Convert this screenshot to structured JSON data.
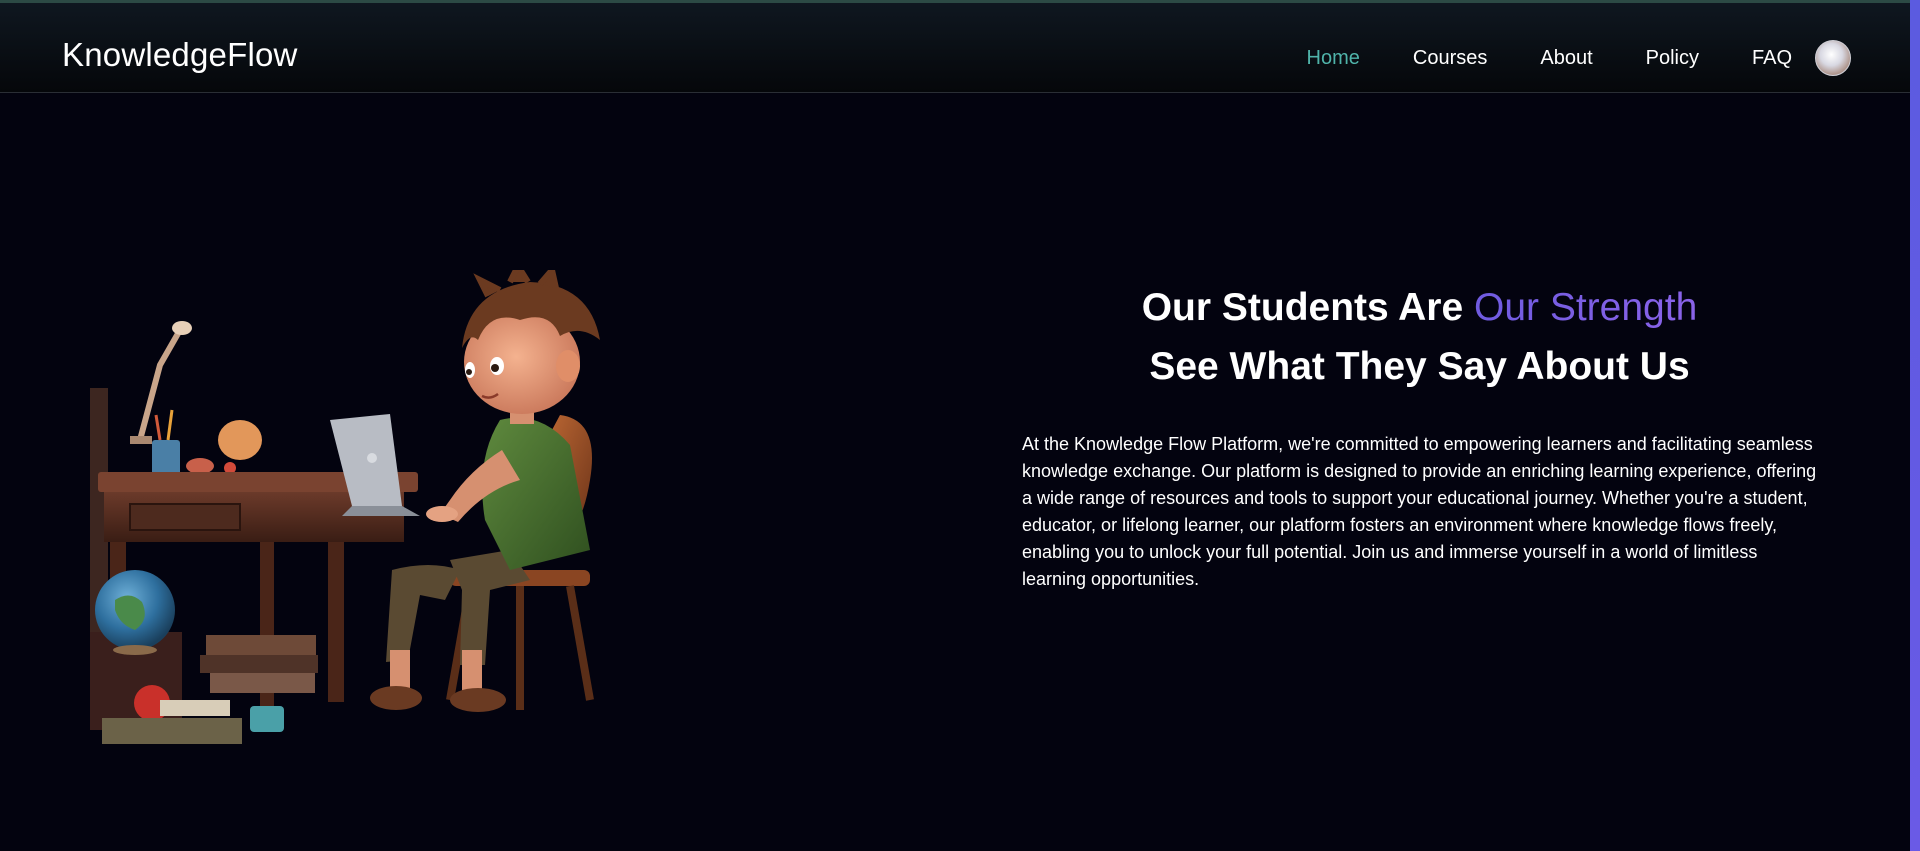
{
  "brand": {
    "name": "KnowledgeFlow"
  },
  "nav": {
    "items": [
      {
        "label": "Home",
        "active": true
      },
      {
        "label": "Courses",
        "active": false
      },
      {
        "label": "About",
        "active": false
      },
      {
        "label": "Policy",
        "active": false
      },
      {
        "label": "FAQ",
        "active": false
      }
    ]
  },
  "user": {
    "avatar_icon": "user-avatar"
  },
  "hero": {
    "heading_line1_prefix": "Our Students Are ",
    "heading_line1_accent": "Our Strength",
    "heading_line2": "See What They Say About Us",
    "description": "At the Knowledge Flow Platform, we're committed to empowering learners and facilitating seamless knowledge exchange. Our platform is designed to provide an enriching learning experience, offering a wide range of resources and tools to support your educational journey. Whether you're a student, educator, or lifelong learner, our platform fosters an environment where knowledge flows freely, enabling you to unlock your full potential. Join us and immerse yourself in a world of limitless learning opportunities.",
    "illustration": "boy-studying-at-desk-with-laptop"
  },
  "colors": {
    "background": "#03030f",
    "nav_active": "#4fb3a9",
    "accent": "#7a60e6",
    "text": "#ffffff"
  }
}
